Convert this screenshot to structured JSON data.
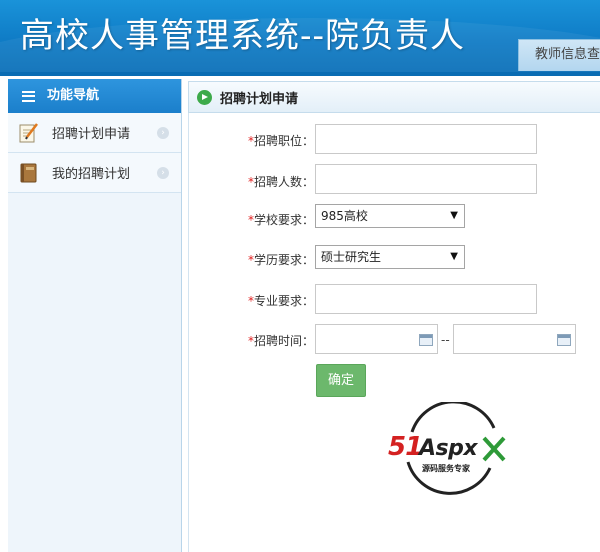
{
  "header": {
    "title": "高校人事管理系统--院负责人",
    "tab_label": "教师信息查"
  },
  "sidebar": {
    "heading": "功能导航",
    "items": [
      {
        "label": "招聘计划申请",
        "icon": "edit-notepad-icon"
      },
      {
        "label": "我的招聘计划",
        "icon": "book-icon"
      }
    ]
  },
  "main": {
    "panel_title": "招聘计划申请",
    "required_mark": "*",
    "fields": {
      "position": {
        "label": "招聘职位：",
        "value": ""
      },
      "count": {
        "label": "招聘人数：",
        "value": ""
      },
      "school": {
        "label": "学校要求：",
        "selected": "985高校"
      },
      "education": {
        "label": "学历要求：",
        "selected": "硕士研究生"
      },
      "major": {
        "label": "专业要求：",
        "value": ""
      },
      "time": {
        "label": "招聘时间：",
        "start": "",
        "end": "",
        "separator": "--"
      }
    },
    "submit_label": "确定"
  },
  "watermark": {
    "brand": "51Aspx",
    "tagline": "源码服务专家"
  },
  "colors": {
    "header_blue": "#1a93d9",
    "submit_green": "#6cb86c",
    "required_red": "#e02020",
    "go_icon_green": "#3daa4a"
  }
}
